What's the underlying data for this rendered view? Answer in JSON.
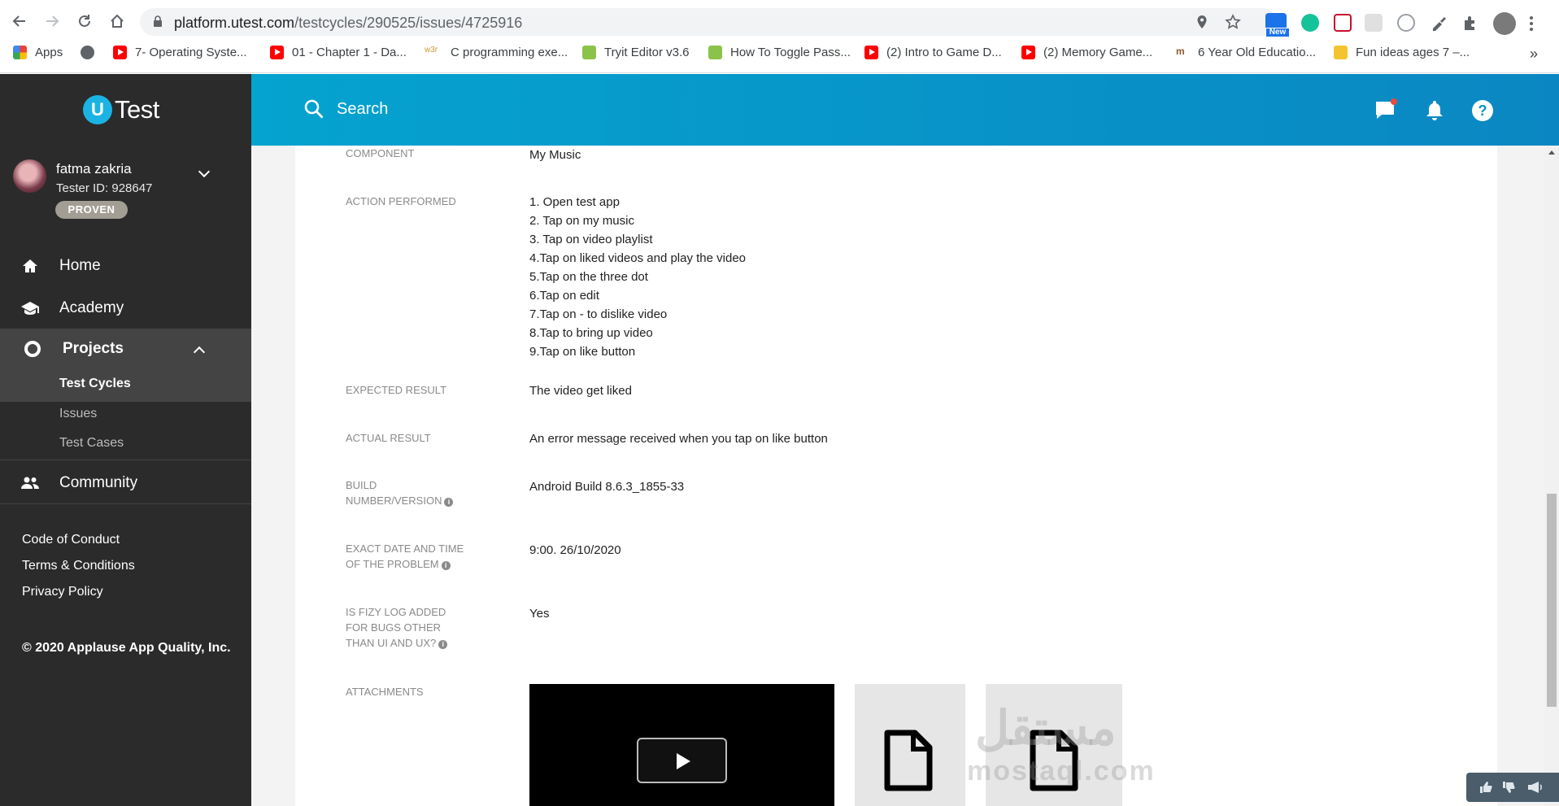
{
  "browser": {
    "url_host": "platform.utest.com",
    "url_path": "/testcycles/290525/issues/4725916",
    "bookmarks": [
      {
        "label": "Apps",
        "icon": "apps-grid-icon"
      },
      {
        "label": "",
        "icon": "globe-icon"
      },
      {
        "label": "7- Operating Syste...",
        "icon": "youtube-icon"
      },
      {
        "label": "01 - Chapter 1 - Da...",
        "icon": "youtube-icon"
      },
      {
        "label": "C programming exe...",
        "icon": "w3r-icon"
      },
      {
        "label": "Tryit Editor v3.6",
        "icon": "w3schools-icon"
      },
      {
        "label": "How To Toggle Pass...",
        "icon": "w3schools-icon"
      },
      {
        "label": "(2) Intro to Game D...",
        "icon": "youtube-icon"
      },
      {
        "label": "(2) Memory Game...",
        "icon": "youtube-icon"
      },
      {
        "label": "6 Year Old Educatio...",
        "icon": "site-icon"
      },
      {
        "label": "Fun ideas ages 7 –...",
        "icon": "smiley-icon"
      }
    ],
    "more_label": "»",
    "ext_badge": "New"
  },
  "sidebar": {
    "logo_letter": "U",
    "logo_text": "Test",
    "user_name": "fatma zakria",
    "tester_id": "Tester ID: 928647",
    "badge": "PROVEN",
    "nav": {
      "home": "Home",
      "academy": "Academy",
      "projects": "Projects",
      "test_cycles": "Test Cycles",
      "issues": "Issues",
      "test_cases": "Test Cases",
      "community": "Community"
    },
    "footer_links": [
      "Code of Conduct",
      "Terms & Conditions",
      "Privacy Policy"
    ],
    "copyright": "© 2020 Applause App Quality, Inc."
  },
  "header": {
    "search_label": "Search"
  },
  "issue": {
    "component_label": "COMPONENT",
    "component_value": "My Music",
    "action_label": "ACTION PERFORMED",
    "actions": [
      "1. Open test app",
      "2. Tap on my music",
      "3. Tap on video playlist",
      "4.Tap on liked videos and play the video",
      "5.Tap on the three dot",
      "6.Tap on edit",
      "7.Tap on - to dislike video",
      "8.Tap to bring up video",
      "9.Tap on like button"
    ],
    "expected_label": "EXPECTED RESULT",
    "expected_value": "The video get liked",
    "actual_label": "ACTUAL RESULT",
    "actual_value": "An error message received when you tap on like button",
    "build_label_1": "BUILD",
    "build_label_2": "NUMBER/VERSION",
    "build_value": "Android Build 8.6.3_1855-33",
    "date_label_1": "EXACT DATE AND TIME",
    "date_label_2": "OF THE PROBLEM",
    "date_value": "9:00. 26/10/2020",
    "fizy_label_1": "IS FIZY LOG ADDED",
    "fizy_label_2": "FOR BUGS OTHER",
    "fizy_label_3": "THAN UI AND UX?",
    "fizy_value": "Yes",
    "attachments_label": "ATTACHMENTS",
    "info_glyph": "i"
  },
  "watermark": {
    "arabic": "مستقل",
    "latin": "mostaql.com"
  }
}
